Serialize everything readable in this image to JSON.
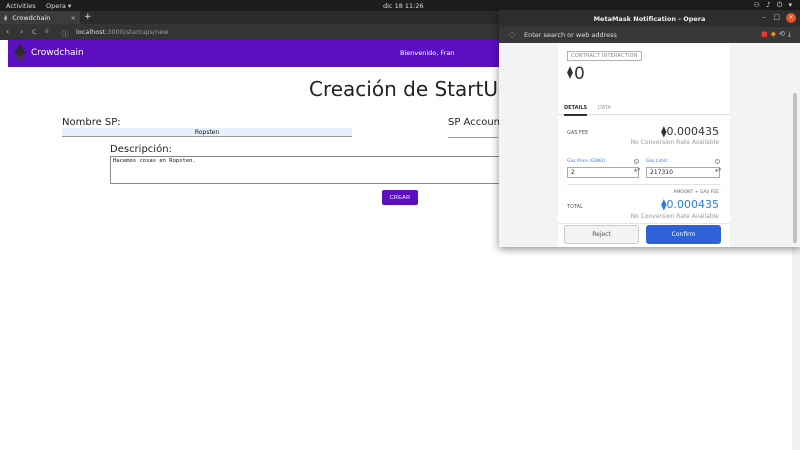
{
  "system_bar": {
    "activities": "Activities",
    "app_name": "Opera",
    "app_caret": "▾",
    "clock": "dic 18  11:26",
    "tray": "⚇ ♪ ⏻ ▾"
  },
  "browser": {
    "tab_title": "Crowdchain",
    "tab_close": "×",
    "new_tab": "+",
    "nav_back": "‹",
    "nav_forward": "›",
    "nav_reload": "C",
    "nav_grid": "⁞⁞",
    "nav_secure": "ⓘ",
    "url_host": "localhost",
    "url_path": ":3000/startups/new"
  },
  "app": {
    "brand": "Crowdchain",
    "welcome": "Bienvenido, Fran",
    "heading": "Creación de StartUp",
    "form": {
      "nombre_label": "Nombre SP:",
      "nombre_value": "Ropsten",
      "account_label": "SP Account:",
      "descripcion_label": "Descripción:",
      "descripcion_value": "Hacemos cosas en Ropsten.",
      "submit_label": "CREAR"
    }
  },
  "metamask": {
    "window_title": "MetaMask Notification - Opera",
    "win_min": "–",
    "win_max": "□",
    "win_close": "×",
    "address_placeholder": "Enter search or web address",
    "address_bubble": "◌",
    "address_icons": {
      "red": "■",
      "fox": "◆",
      "ext": "⟲",
      "download": "⤓"
    },
    "contract_interaction": "CONTRACT INTERACTION",
    "eth_symbol": "⧫",
    "total_amount": "0",
    "tabs": [
      "DETAILS",
      "DATA"
    ],
    "gas_fee_label": "GAS FEE",
    "gas_fee_value": "⧫0.000435",
    "gas_fee_conversion": "No Conversion Rate Available",
    "gas_price_label": "Gas Price (GWEI)",
    "gas_price_value": "2",
    "gas_limit_label": "Gas Limit",
    "gas_limit_value": "217310",
    "info_glyph": "i",
    "spin_glyph": "▲▼",
    "amount_gas_label": "AMOUNT + GAS FEE",
    "total_label": "TOTAL",
    "total_value": "⧫0.000435",
    "total_conversion": "No Conversion Rate Available",
    "reject_label": "Reject",
    "confirm_label": "Confirm"
  }
}
